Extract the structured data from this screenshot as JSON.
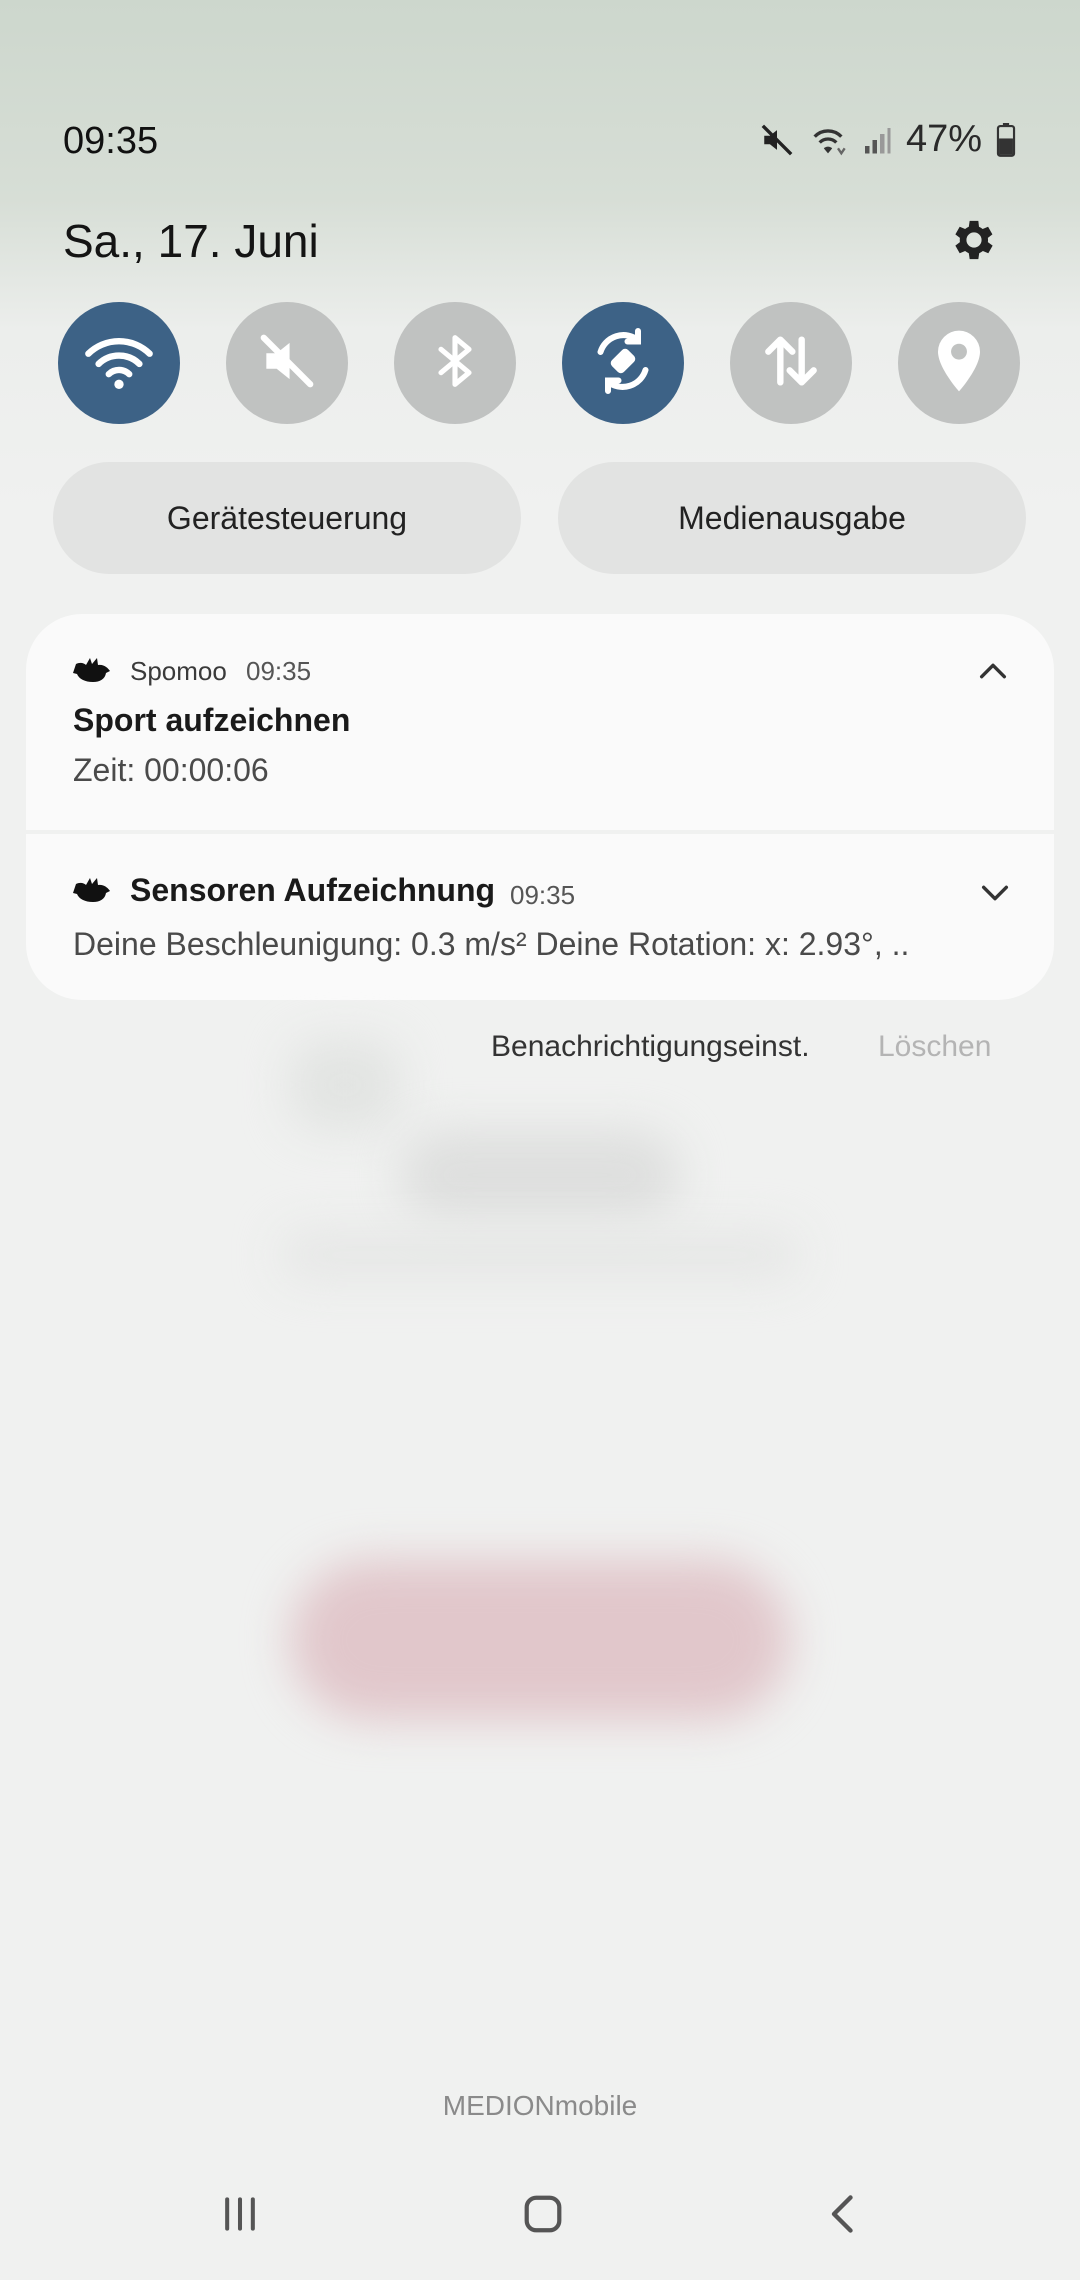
{
  "status_bar": {
    "time": "09:35",
    "battery_percent": "47%",
    "icons": [
      "mute-icon",
      "wifi-icon",
      "signal-icon",
      "battery-icon"
    ]
  },
  "header": {
    "date": "Sa., 17. Juni",
    "settings_icon": "gear-icon"
  },
  "quick_toggles": [
    {
      "name": "wifi",
      "icon": "wifi-icon",
      "state": "on"
    },
    {
      "name": "sound",
      "icon": "mute-icon",
      "state": "off"
    },
    {
      "name": "bluetooth",
      "icon": "bluetooth-icon",
      "state": "off"
    },
    {
      "name": "auto-rotate",
      "icon": "rotate-icon",
      "state": "on"
    },
    {
      "name": "mobile-data",
      "icon": "data-arrows-icon",
      "state": "off"
    },
    {
      "name": "location",
      "icon": "location-pin-icon",
      "state": "off"
    }
  ],
  "pills": {
    "device_control": "Gerätesteuerung",
    "media_output": "Medienausgabe"
  },
  "notifications": [
    {
      "app": "Spomoo",
      "time": "09:35",
      "title": "Sport aufzeichnen",
      "text": "Zeit: 00:00:06",
      "expanded": true
    },
    {
      "title": "Sensoren Aufzeichnung",
      "time": "09:35",
      "text": "Deine Beschleunigung: 0.3 m/s² Deine Rotation: x: 2.93°, ..",
      "expanded": false
    }
  ],
  "footer": {
    "settings_label": "Benachrichtigungseinst.",
    "clear_label": "Löschen"
  },
  "carrier": "MEDIONmobile",
  "colors": {
    "toggle_on": "#3d6286",
    "toggle_off": "#c0c2c1"
  }
}
